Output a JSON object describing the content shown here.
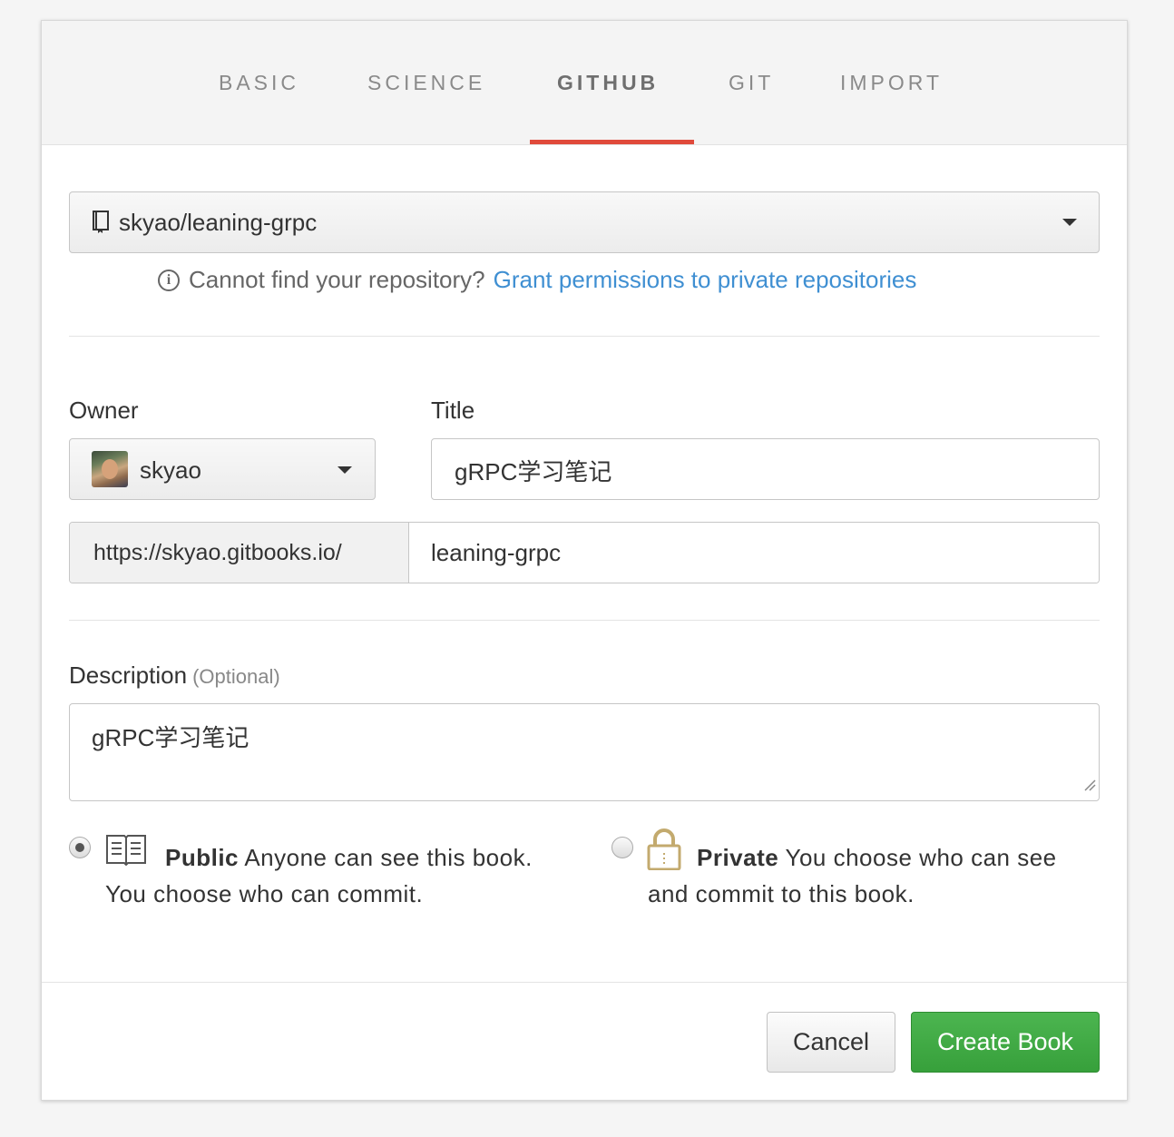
{
  "tabs": [
    {
      "label": "BASIC"
    },
    {
      "label": "SCIENCE"
    },
    {
      "label": "GITHUB"
    },
    {
      "label": "GIT"
    },
    {
      "label": "IMPORT"
    }
  ],
  "active_tab": "GITHUB",
  "accent_color": "#e04a3b",
  "repository": {
    "selected": "skyao/leaning-grpc",
    "icon": "book-icon"
  },
  "hint": {
    "text": "Cannot find your repository?",
    "link": "Grant permissions to private repositories",
    "link_color": "#3f8fd2"
  },
  "owner": {
    "label": "Owner",
    "value": "skyao"
  },
  "title": {
    "label": "Title",
    "value": "gRPC学习笔记"
  },
  "url": {
    "prefix": "https://skyao.gitbooks.io/",
    "slug": "leaning-grpc"
  },
  "description": {
    "label": "Description",
    "optional": "(Optional)",
    "value": "gRPC学习笔记"
  },
  "visibility": {
    "public": {
      "title": "Public",
      "text": "Anyone can see this book. You choose who can commit.",
      "checked": true,
      "icon": "open-book-icon"
    },
    "private": {
      "title": "Private",
      "text": "You choose who can see and commit to this book.",
      "checked": false,
      "icon": "lock-icon"
    }
  },
  "buttons": {
    "cancel": "Cancel",
    "create": "Create Book",
    "create_color": "#3ea842"
  }
}
